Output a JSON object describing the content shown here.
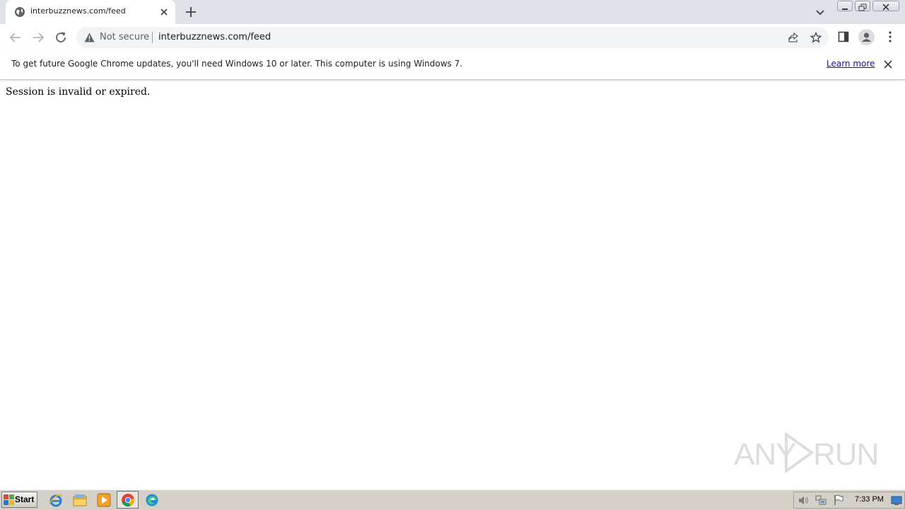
{
  "tab": {
    "title": "interbuzznews.com/feed"
  },
  "omnibox": {
    "security_label": "Not secure",
    "url": "interbuzznews.com/feed"
  },
  "infobar": {
    "message": "To get future Google Chrome updates, you'll need Windows 10 or later. This computer is using Windows 7.",
    "link": "Learn more"
  },
  "page": {
    "message": "Session is invalid or expired."
  },
  "watermark": {
    "text_left": "ANY",
    "text_right": "RUN"
  },
  "taskbar": {
    "start_label": "Start",
    "clock": "7:33 PM"
  },
  "colors": {
    "tab_strip": "#dee1e6",
    "link": "#1a0dab",
    "taskbar": "#d4d0c8"
  }
}
